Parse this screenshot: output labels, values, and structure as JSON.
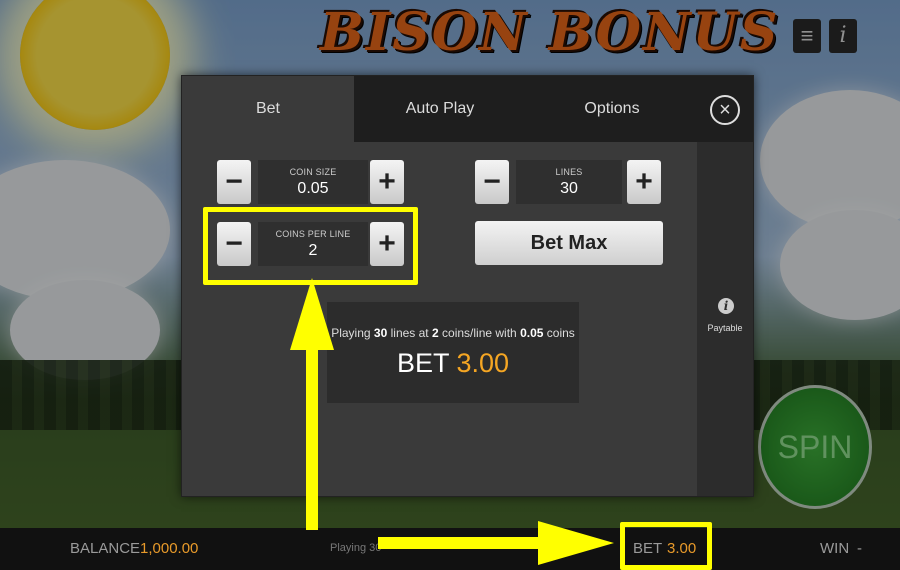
{
  "game": {
    "title": "BISON BONUS"
  },
  "top_buttons": {
    "menu_icon": "hamburger-menu-icon",
    "info_icon": "info-icon"
  },
  "tabs": [
    {
      "label": "Bet",
      "active": true
    },
    {
      "label": "Auto Play",
      "active": false
    },
    {
      "label": "Options",
      "active": false
    }
  ],
  "controls": {
    "coin_size": {
      "label": "COIN SIZE",
      "value": "0.05"
    },
    "coins_per_line": {
      "label": "COINS PER LINE",
      "value": "2"
    },
    "lines": {
      "label": "LINES",
      "value": "30"
    },
    "minus_symbol": "−",
    "plus_symbol": "+"
  },
  "bet_max_label": "Bet Max",
  "summary": {
    "prefix": "Playing",
    "lines": "30",
    "mid1": "lines at",
    "coins": "2",
    "mid2": "coins/line with",
    "coin_size": "0.05",
    "suffix": "coins",
    "bet_label": "BET",
    "bet_amount": "3.00"
  },
  "sidebar": {
    "paytable_label": "Paytable"
  },
  "spin_label": "SPIN",
  "bottom_bar": {
    "balance_label": "BALANCE",
    "balance_value": "1,000.00",
    "playing_text": "Playing 30",
    "bet_label": "BET",
    "bet_value": "3.00",
    "win_label": "WIN",
    "win_value": "-"
  },
  "colors": {
    "highlight": "#ffff00",
    "accent_amount": "#f5a623",
    "spin_green": "#2e8f2e"
  }
}
